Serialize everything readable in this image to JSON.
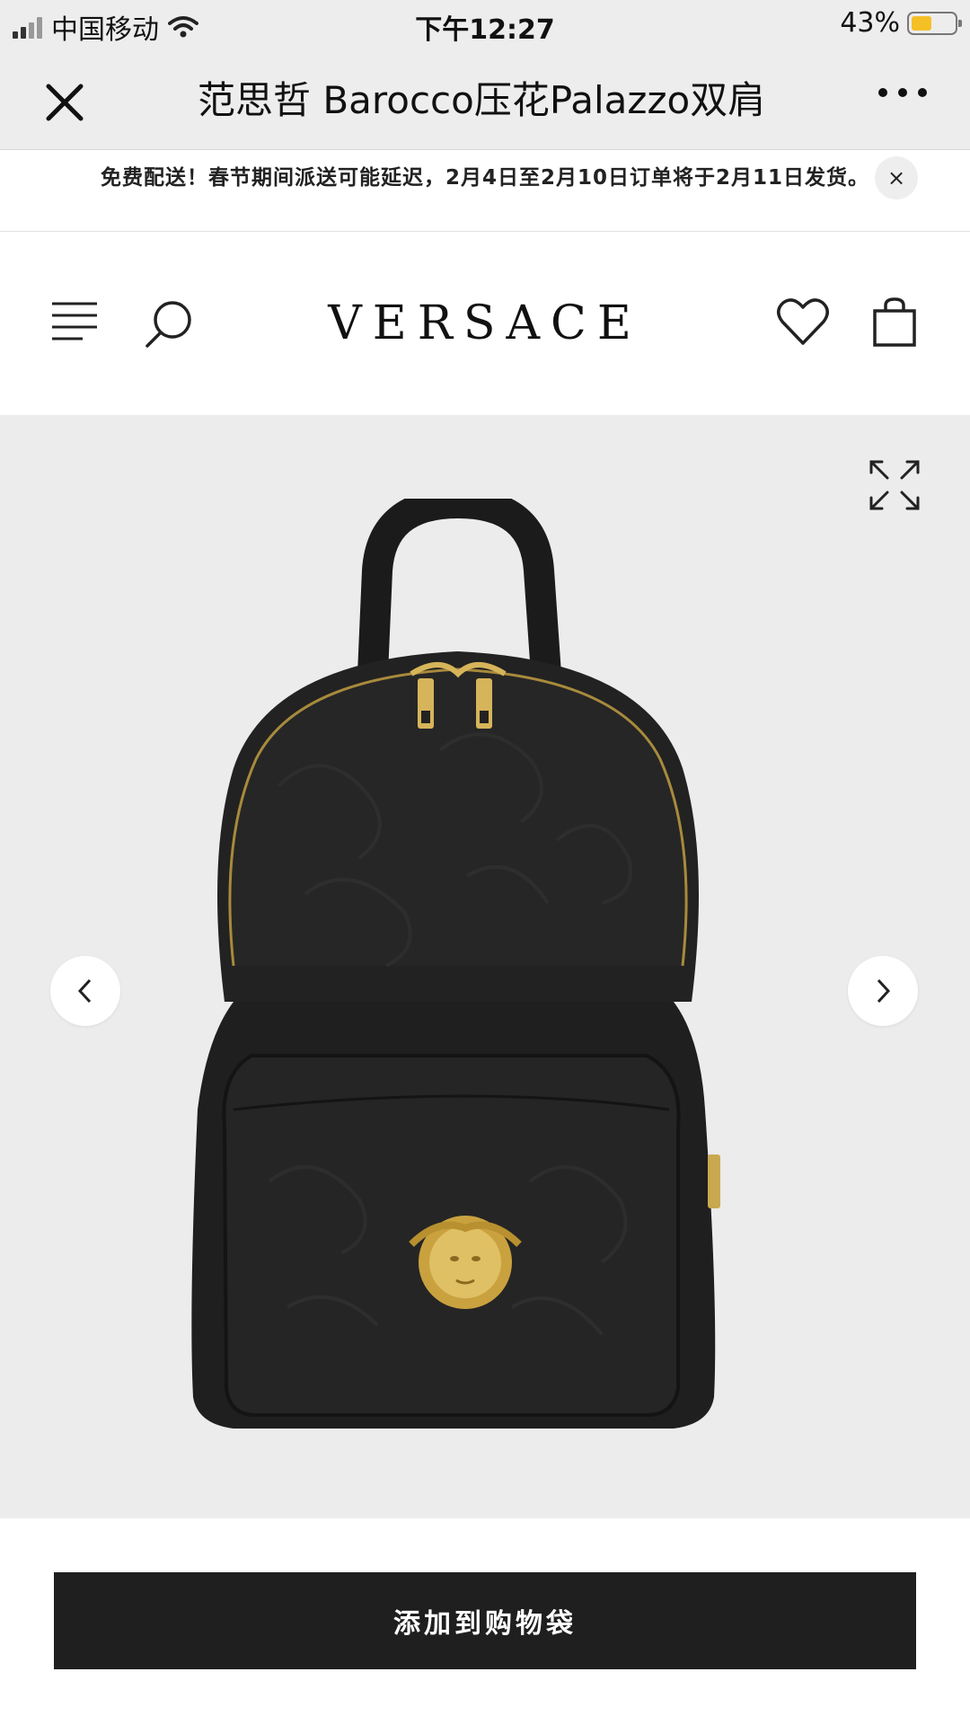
{
  "status_bar": {
    "carrier": "中国移动",
    "time": "下午12:27",
    "battery": "43%"
  },
  "title_bar": {
    "title": "范思哲 Barocco压花Palazzo双肩"
  },
  "banner": {
    "text": "免费配送！春节期间派送可能延迟，2月4日至2月10日订单将于2月11日发货。",
    "close": "×"
  },
  "header": {
    "logo": "VERSACE"
  },
  "product": {
    "add_to_bag": "添加到购物袋"
  },
  "colors": {
    "battery_fill": "#f5c026",
    "button_bg": "#1f1f1f",
    "gallery_bg": "#ececec",
    "bag_leather": "#1e1e1e",
    "hardware_gold": "#d6b45a"
  }
}
